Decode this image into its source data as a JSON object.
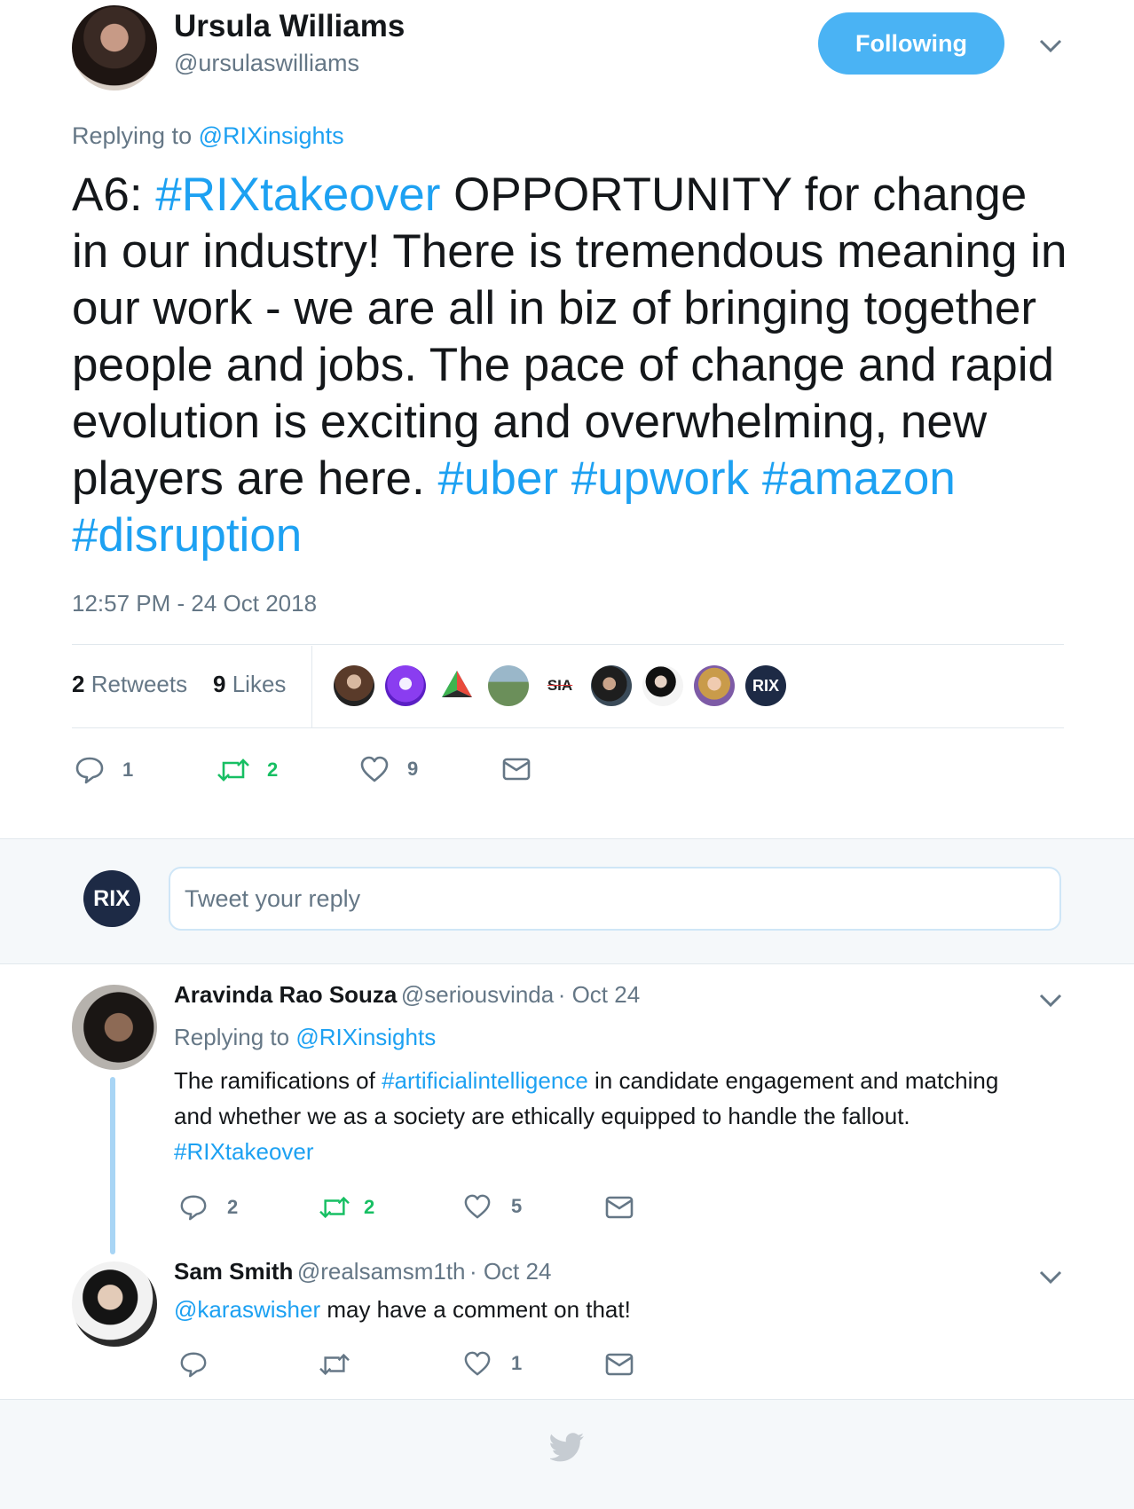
{
  "main_tweet": {
    "author_name": "Ursula Williams",
    "author_handle": "@ursulaswilliams",
    "follow_label": "Following",
    "replying_prefix": "Replying to",
    "replying_to": "@RIXinsights",
    "text_parts": {
      "p1": "A6: ",
      "h1": "#RIXtakeover",
      "p2": " OPPORTUNITY for change in our industry! There is tremendous meaning in our work - we are all in biz of bringing together people and jobs. The pace of change and rapid evolution is exciting and overwhelming, new players are here. ",
      "h2": "#uber",
      "h3": "#upwork",
      "h4": "#amazon",
      "h5": "#disruption"
    },
    "timestamp": "12:57 PM - 24 Oct 2018",
    "stats": {
      "retweets_count": "2",
      "retweets_label": "Retweets",
      "likes_count": "9",
      "likes_label": "Likes"
    },
    "liker_badges": {
      "sia": "SIA",
      "rix": "RIX"
    },
    "actions": {
      "reply_count": "1",
      "retweet_count": "2",
      "like_count": "9"
    }
  },
  "compose": {
    "avatar_label": "RIX",
    "placeholder": "Tweet your reply"
  },
  "replies": [
    {
      "name": "Aravinda Rao Souza",
      "handle": "@seriousvinda",
      "date": "· Oct 24",
      "replying_prefix": "Replying to",
      "replying_to": "@RIXinsights",
      "text_parts": {
        "p1": "The ramifications of ",
        "h1": "#artificialintelligence",
        "p2": " in candidate engagement and matching and whether we as a society are ethically equipped to handle the fallout. ",
        "h2": "#RIXtakeover"
      },
      "actions": {
        "reply_count": "2",
        "retweet_count": "2",
        "like_count": "5"
      }
    },
    {
      "name": "Sam Smith",
      "handle": "@realsamsm1th",
      "date": "· Oct 24",
      "text_parts": {
        "m1": "@karaswisher",
        "p1": " may have a comment on that!"
      },
      "actions": {
        "like_count": "1"
      }
    }
  ],
  "icons": {
    "reply": "reply-icon",
    "retweet": "retweet-icon",
    "like": "heart-icon",
    "dm": "envelope-icon",
    "more": "chevron-down-icon",
    "footer": "twitter-bird-icon"
  },
  "colors": {
    "link": "#1da1f2",
    "follow_button": "#4ab3f4",
    "retweet_green": "#17bf63",
    "muted": "#657786",
    "rix_logo": "#1d2a45"
  }
}
